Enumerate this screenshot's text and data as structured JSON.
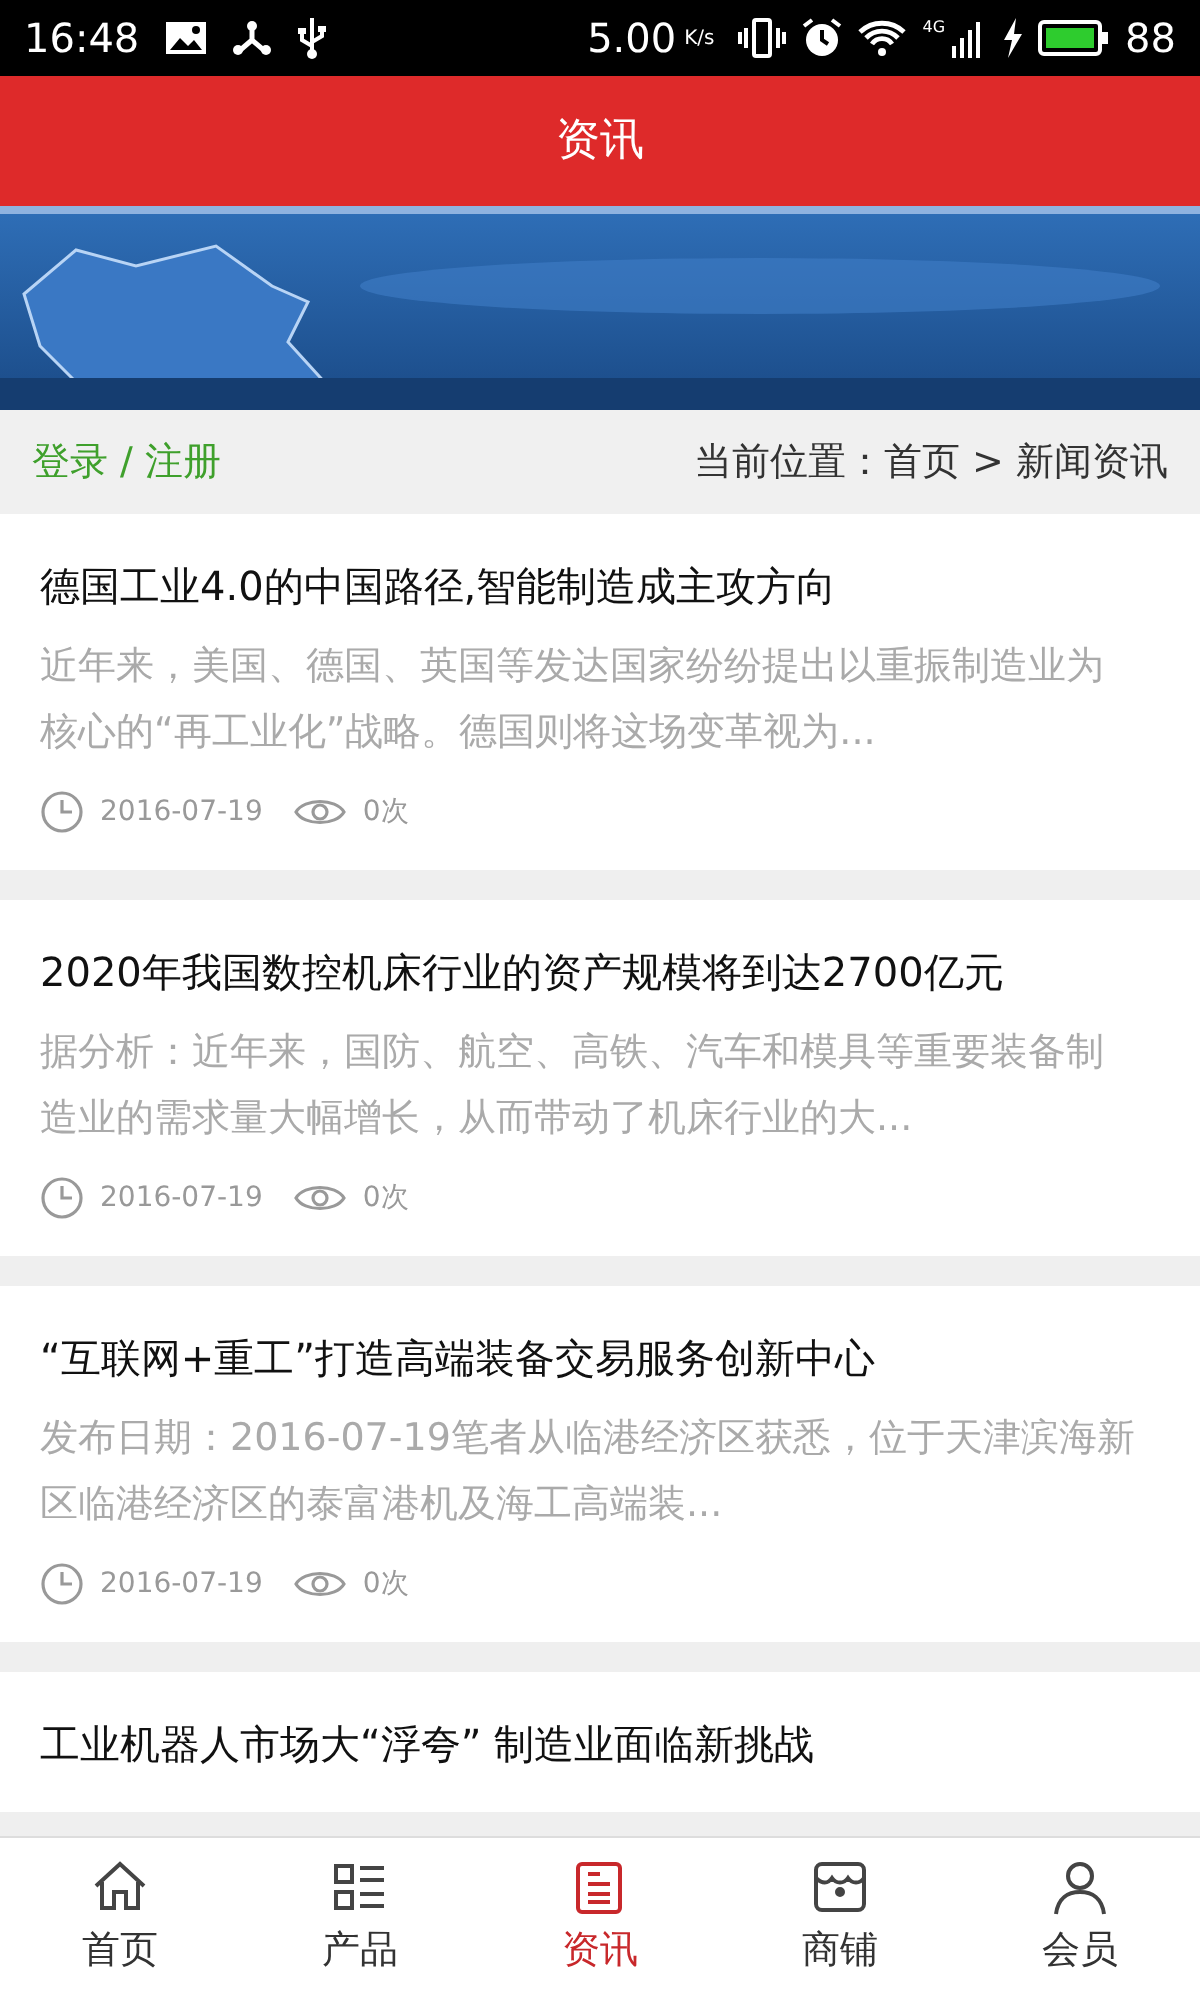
{
  "status_bar": {
    "time": "16:48",
    "speed": "5.00",
    "speed_unit": "K/s",
    "network": "4G",
    "battery": "88"
  },
  "header": {
    "title": "资讯"
  },
  "breadcrumb": {
    "login": "登录",
    "separator": "/",
    "register": "注册",
    "location": "当前位置：首页 > 新闻资讯"
  },
  "articles": [
    {
      "title": "德国工业4.0的中国路径,智能制造成主攻方向",
      "summary": "近年来，美国、德国、英国等发达国家纷纷提出以重振制造业为核心的“再工业化”战略。德国则将这场变革视为...",
      "date": "2016-07-19",
      "views": "0次"
    },
    {
      "title": "2020年我国数控机床行业的资产规模将到达2700亿元",
      "summary": "据分析：近年来，国防、航空、高铁、汽车和模具等重要装备制造业的需求量大幅增长，从而带动了机床行业的大...",
      "date": "2016-07-19",
      "views": "0次"
    },
    {
      "title": "“互联网+重工”打造高端装备交易服务创新中心",
      "summary": "发布日期：2016-07-19笔者从临港经济区获悉，位于天津滨海新区临港经济区的泰富港机及海工高端装...",
      "date": "2016-07-19",
      "views": "0次"
    },
    {
      "title": "工业机器人市场大“浮夸” 制造业面临新挑战"
    }
  ],
  "nav": [
    {
      "label": "首页",
      "kind": "home",
      "selected": false
    },
    {
      "label": "产品",
      "kind": "list",
      "selected": false
    },
    {
      "label": "资讯",
      "kind": "news",
      "selected": true
    },
    {
      "label": "商铺",
      "kind": "shop",
      "selected": false
    },
    {
      "label": "会员",
      "kind": "user",
      "selected": false
    }
  ]
}
